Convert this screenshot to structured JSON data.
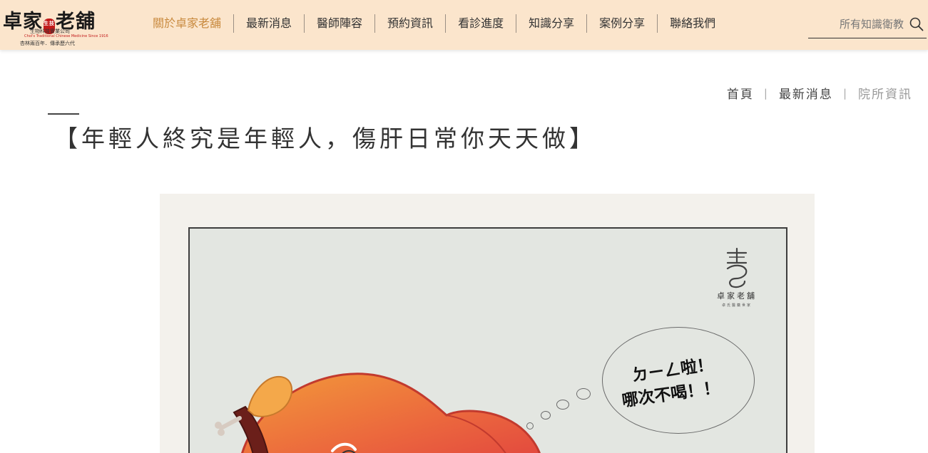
{
  "logo": {
    "main_part1": "卓家",
    "seal_text": "生技",
    "main_part2": "老舖",
    "sub1": "生物科技實業公司",
    "sub2": "Chol's Traditional Chinese Medicine Since 1916",
    "sub3": "杏林兩百年．傳承歷六代"
  },
  "nav": {
    "items": [
      {
        "label": "關於卓家老舖",
        "active": true
      },
      {
        "label": "最新消息"
      },
      {
        "label": "醫師陣容"
      },
      {
        "label": "預約資訊"
      },
      {
        "label": "看診進度"
      },
      {
        "label": "知識分享"
      },
      {
        "label": "案例分享"
      },
      {
        "label": "聯絡我們"
      }
    ]
  },
  "search": {
    "placeholder": "所有知識衛教",
    "icon": "search-icon"
  },
  "breadcrumb": {
    "items": [
      "首頁",
      "最新消息",
      "院所資訊"
    ],
    "separator": "|"
  },
  "article": {
    "title": "【年輕人終究是年輕人，傷肝日常你天天做】",
    "image": {
      "brand_name": "卓家老舖",
      "brand_sub": "卓氏醫藥世家",
      "bubble_line1": "ㄉㄧㄥ啦！",
      "bubble_line2": "哪次不喝！！"
    }
  },
  "colors": {
    "header_bg": "#fbe5cc",
    "nav_active": "#c8893d",
    "seal_red": "#c21b1b",
    "image_bg": "#e3e6e1"
  }
}
